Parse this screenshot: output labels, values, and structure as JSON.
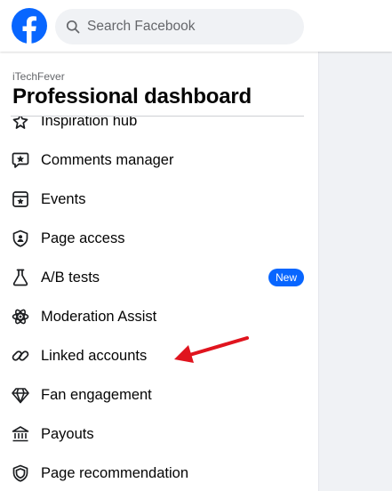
{
  "header": {
    "search_placeholder": "Search Facebook",
    "brand_color": "#0866ff"
  },
  "sidebar": {
    "page_name": "iTechFever",
    "title": "Professional dashboard",
    "items": [
      {
        "label": "Inspiration hub",
        "icon": "sparkle-icon"
      },
      {
        "label": "Comments manager",
        "icon": "comment-star-icon"
      },
      {
        "label": "Events",
        "icon": "calendar-star-icon"
      },
      {
        "label": "Page access",
        "icon": "shield-person-icon"
      },
      {
        "label": "A/B tests",
        "icon": "flask-icon",
        "badge": "New"
      },
      {
        "label": "Moderation Assist",
        "icon": "atom-icon"
      },
      {
        "label": "Linked accounts",
        "icon": "link-icon"
      },
      {
        "label": "Fan engagement",
        "icon": "diamond-icon"
      },
      {
        "label": "Payouts",
        "icon": "bank-icon"
      },
      {
        "label": "Page recommendation",
        "icon": "shield-check-icon"
      }
    ]
  },
  "annotation": {
    "arrow_color": "#e0141e",
    "points_to": "Linked accounts"
  }
}
